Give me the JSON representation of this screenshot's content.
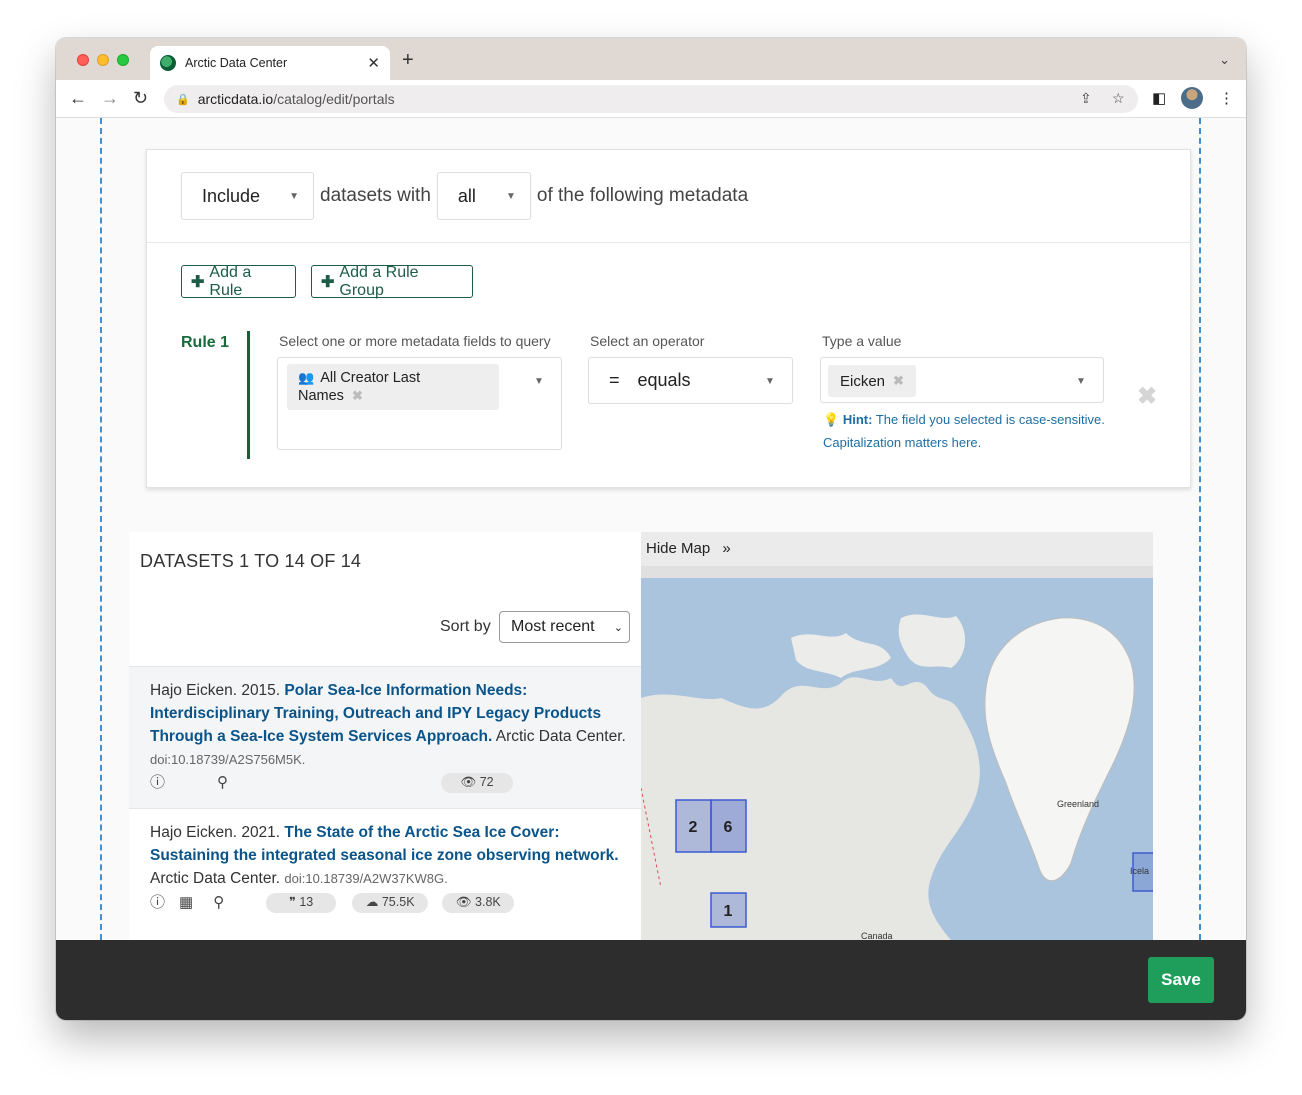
{
  "browser": {
    "tab_title": "Arctic Data Center",
    "url_host": "arcticdata.io",
    "url_path": "/catalog/edit/portals"
  },
  "query": {
    "include_value": "Include",
    "datasets_with_text": "datasets with",
    "match_value": "all",
    "following_text": "of the following metadata",
    "add_rule_label": "Add a Rule",
    "add_rule_group_label": "Add a Rule Group"
  },
  "rule": {
    "label": "Rule 1",
    "field_label": "Select one or more metadata fields to query",
    "field_chip_line1": "All Creator Last",
    "field_chip_line2": "Names",
    "operator_label": "Select an operator",
    "operator_symbol": "=",
    "operator_value": "equals",
    "value_label": "Type a value",
    "value_chip": "Eicken",
    "hint_bold": "Hint:",
    "hint_text": "The field you selected is case-sensitive. Capitalization matters here."
  },
  "results": {
    "heading": "DATASETS 1 TO 14 OF 14",
    "sort_label": "Sort by",
    "sort_value": "Most recent",
    "items": [
      {
        "author_year": "Hajo Eicken. 2015.",
        "title": "Polar Sea-Ice Information Needs: Interdisciplinary Training, Outreach and IPY Legacy Products Through a Sea-Ice System Services Approach.",
        "publisher": "Arctic Data Center.",
        "doi": "doi:10.18739/A2S756M5K.",
        "views": "72"
      },
      {
        "author_year": "Hajo Eicken. 2021.",
        "title": "The State of the Arctic Sea Ice Cover: Sustaining the integrated seasonal ice zone observing network.",
        "publisher": "Arctic Data Center.",
        "doi": "doi:10.18739/A2W37KW8G.",
        "citations": "13",
        "downloads": "75.5K",
        "views": "3.8K"
      }
    ]
  },
  "map": {
    "hide_label": "Hide Map",
    "cluster_a": "2",
    "cluster_b": "6",
    "cluster_c": "1",
    "label_greenland": "Greenland",
    "label_canada": "Canada",
    "label_iceland": "Icela"
  },
  "footer": {
    "save_label": "Save"
  },
  "colors": {
    "accent_green": "#1a6b3b",
    "link_blue": "#0b5489",
    "save_green": "#1e9e5a"
  }
}
